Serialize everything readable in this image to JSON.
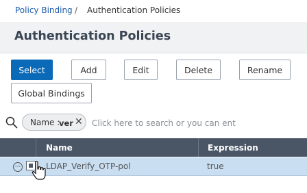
{
  "breadcrumb": {
    "parent": "Policy Binding",
    "separator": "/",
    "current": "Authentication Policies"
  },
  "page": {
    "title": "Authentication Policies"
  },
  "toolbar": {
    "select": "Select",
    "add": "Add",
    "edit": "Edit",
    "delete": "Delete",
    "rename": "Rename",
    "global_bindings": "Global Bindings"
  },
  "search": {
    "chip_key": "Name :",
    "chip_value": "ver",
    "placeholder": "Click here to search or you can enter K"
  },
  "table": {
    "columns": [
      "Name",
      "Expression"
    ],
    "rows": [
      {
        "name": "LDAP_Verify_OTP-pol",
        "expression": "true",
        "selected": true
      }
    ]
  },
  "colors": {
    "primary": "#0b6ab8",
    "header_bg": "#4a5566",
    "selected_row": "#c9def1",
    "link": "#1a5aa8"
  },
  "icons": [
    "search-icon",
    "close-icon",
    "more-options-icon",
    "pointer-cursor-icon"
  ]
}
